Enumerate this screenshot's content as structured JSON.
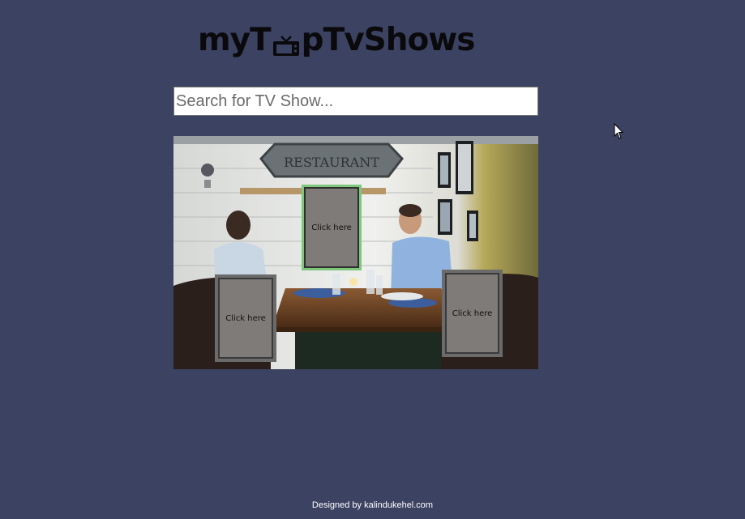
{
  "header": {
    "logo_text_start": "myT",
    "logo_text_end": "pTvShows",
    "logo_icon": "tv-icon"
  },
  "search": {
    "placeholder": "Search for TV Show..."
  },
  "scene": {
    "sign_text": "RESTAURANT",
    "frames": [
      {
        "label": "Click here"
      },
      {
        "label": "Click here"
      },
      {
        "label": "Click here"
      }
    ]
  },
  "footer": {
    "text": "Designed by kalindukehel.com"
  },
  "colors": {
    "background": "#3c4262",
    "highlight_frame": "#7ec87e",
    "frame_fill": "#7e7b78"
  }
}
